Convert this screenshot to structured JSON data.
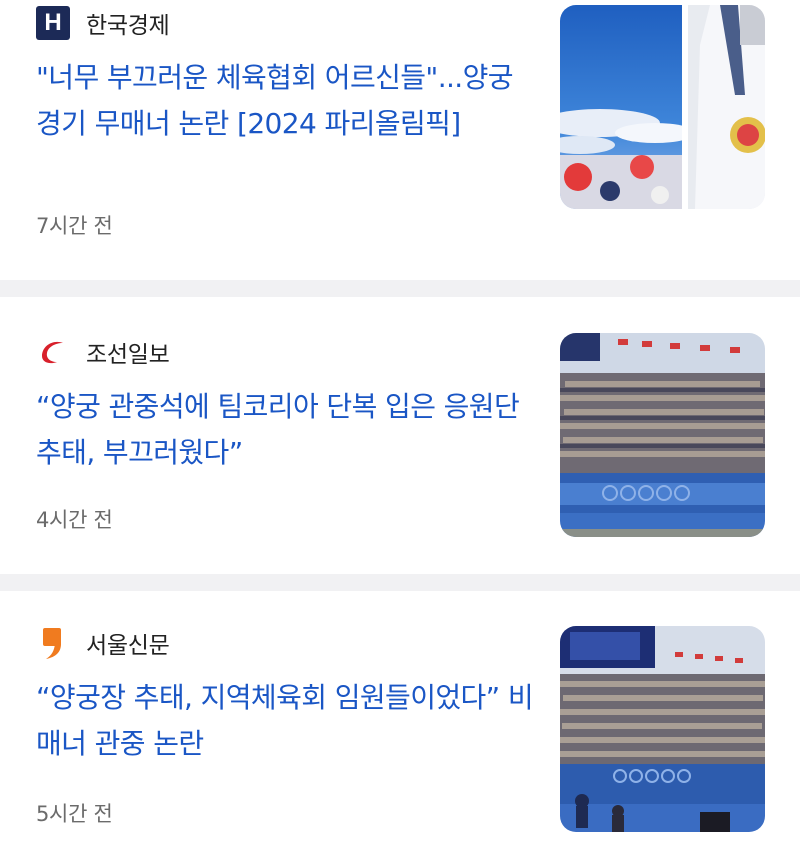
{
  "articles": [
    {
      "source": "한국경제",
      "logo_letter": "H",
      "headline": "\"너무 부끄러운 체육협회 어르신들\"...양궁 경기 무매너 논란 [2024 파리올림픽]",
      "time": "7시간 전",
      "thumbnail_icon": "olympics-photo-thumbnail"
    },
    {
      "source": "조선일보",
      "headline": "“양궁 관중석에 팀코리아 단복 입은 응원단 추태, 부끄러웠다”",
      "time": "4시간 전",
      "thumbnail_icon": "stadium-crowd-thumbnail"
    },
    {
      "source": "서울신문",
      "headline": "“양궁장 추태, 지역체육회 임원들이었다” 비매너 관중 논란",
      "time": "5시간 전",
      "thumbnail_icon": "stadium-crowd-thumbnail"
    }
  ],
  "colors": {
    "headline": "#1a56c5",
    "hankyung_logo": "#1c2a57",
    "chosun_logo": "#d8202b",
    "seoul_logo": "#f07b1f",
    "divider": "#f1f1f3"
  }
}
